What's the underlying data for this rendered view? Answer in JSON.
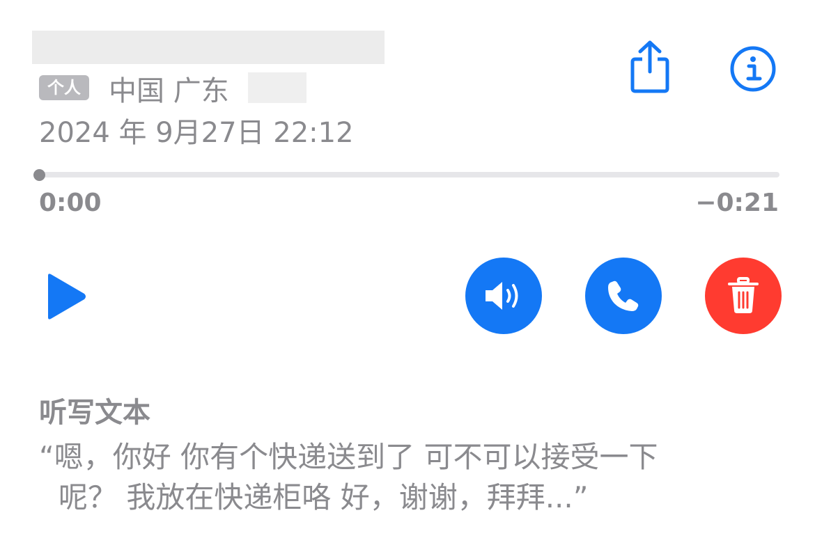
{
  "header": {
    "tag_label": "个人",
    "location": "中国 广东",
    "datetime": "2024 年 9月27日 22:12"
  },
  "player": {
    "elapsed": "0:00",
    "remaining": "−0:21",
    "progress": 0
  },
  "icons": {
    "share": "share-icon",
    "info": "info-icon",
    "play": "play-icon",
    "speaker": "speaker-icon",
    "call": "phone-icon",
    "delete": "trash-icon"
  },
  "colors": {
    "accent": "#1478f5",
    "delete": "#ff3b30",
    "secondary_text": "#8a8a8e"
  },
  "transcript": {
    "title": "听写文本",
    "line1": "“嗯，你好 你有个快递送到了 可不可以接受一下",
    "line2": "呢？ 我放在快递柜咯 好，谢谢，拜拜...”"
  }
}
